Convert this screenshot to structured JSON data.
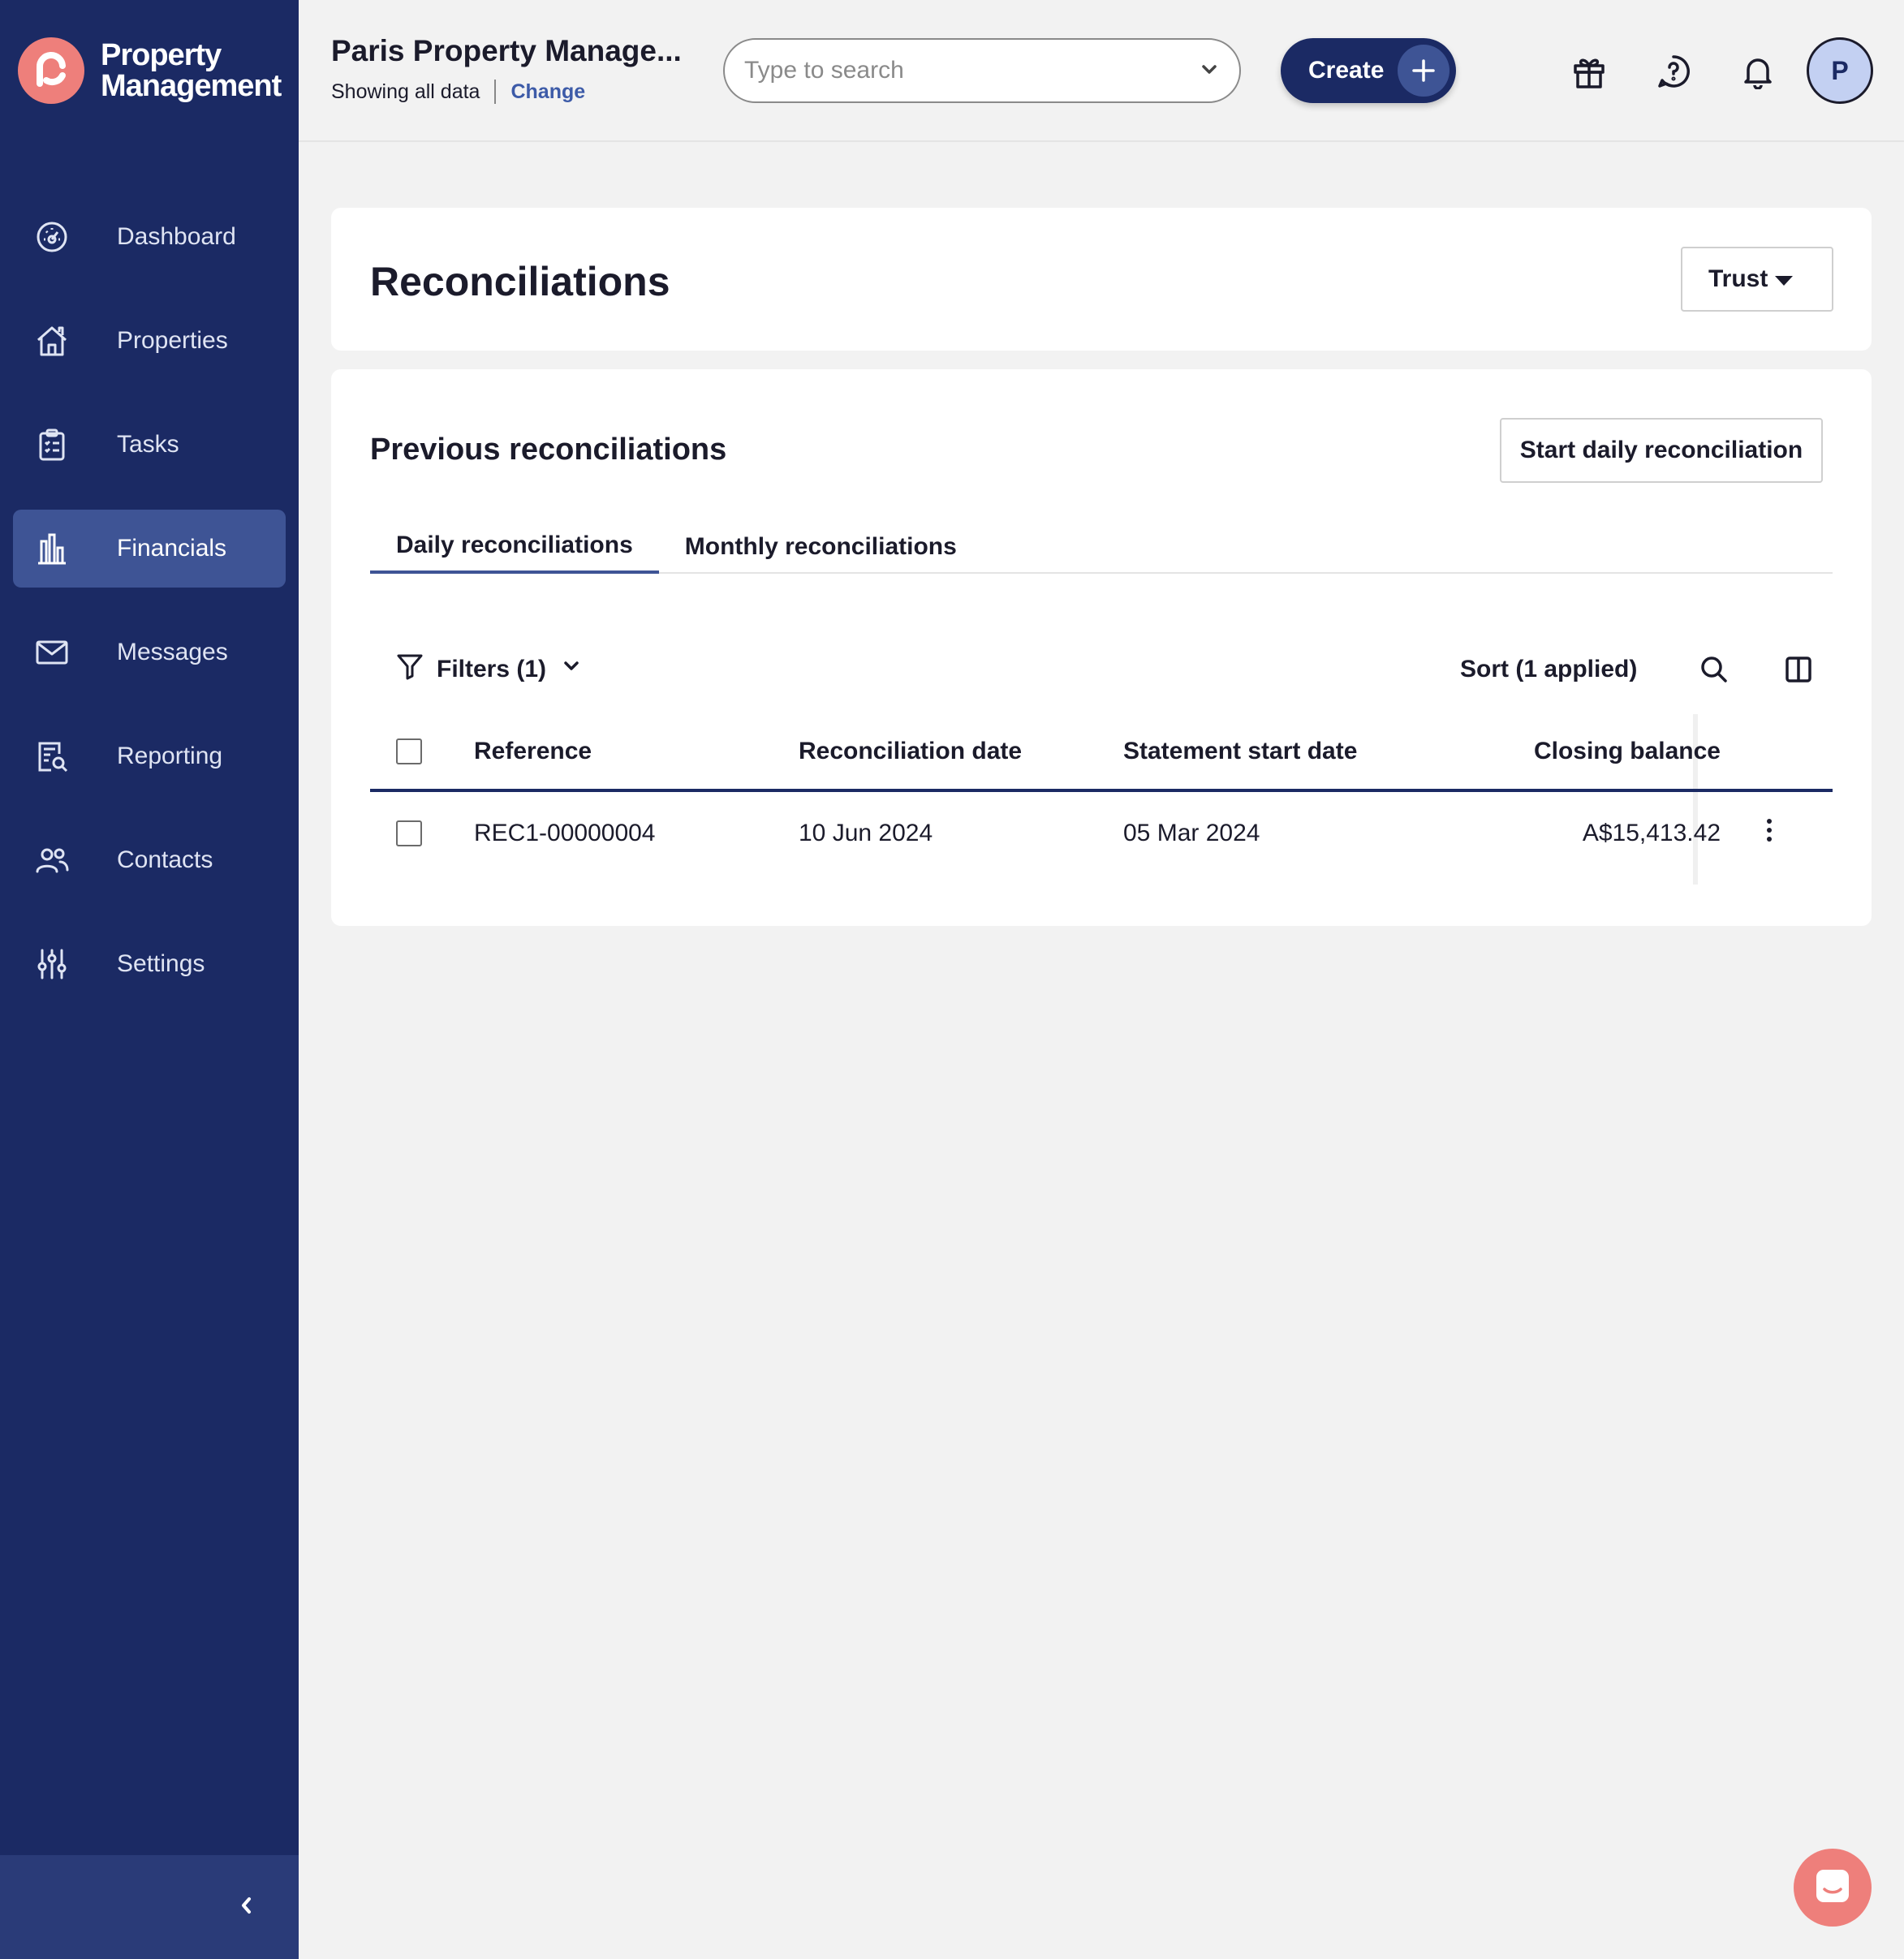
{
  "brand": {
    "line1": "Property",
    "line2": "Management",
    "logo_color": "#ee7f7b"
  },
  "sidebar": {
    "items": [
      {
        "label": "Dashboard",
        "icon": "dashboard-gauge-icon"
      },
      {
        "label": "Properties",
        "icon": "house-icon"
      },
      {
        "label": "Tasks",
        "icon": "clipboard-list-icon"
      },
      {
        "label": "Financials",
        "icon": "bar-chart-icon",
        "active": true
      },
      {
        "label": "Messages",
        "icon": "envelope-icon"
      },
      {
        "label": "Reporting",
        "icon": "report-search-icon"
      },
      {
        "label": "Contacts",
        "icon": "people-icon"
      },
      {
        "label": "Settings",
        "icon": "sliders-icon"
      }
    ],
    "collapse_icon": "chevron-left-icon"
  },
  "header": {
    "org_name": "Paris Property Manage...",
    "showing": "Showing all data",
    "change": "Change",
    "search_placeholder": "Type to search",
    "create_label": "Create",
    "avatar_initial": "P",
    "icons": [
      "gift-icon",
      "help-icon",
      "bell-icon"
    ]
  },
  "page": {
    "title": "Reconciliations",
    "account_select": "Trust"
  },
  "section": {
    "title": "Previous reconciliations",
    "start_button": "Start daily reconciliation",
    "tabs": [
      "Daily reconciliations",
      "Monthly reconciliations"
    ],
    "active_tab": 0,
    "filters_label": "Filters (1)",
    "sort_label": "Sort (1 applied)"
  },
  "table": {
    "columns": [
      "Reference",
      "Reconciliation date",
      "Statement start date",
      "Closing balance"
    ],
    "rows": [
      {
        "reference": "REC1-00000004",
        "reconciliation_date": "10 Jun 2024",
        "statement_start_date": "05 Mar 2024",
        "closing_balance": "A$15,413.42"
      }
    ]
  },
  "colors": {
    "sidebar_bg": "#1b2a64",
    "accent": "#3e5495",
    "brand_coral": "#ee7f7b",
    "link": "#3d5ba8"
  }
}
